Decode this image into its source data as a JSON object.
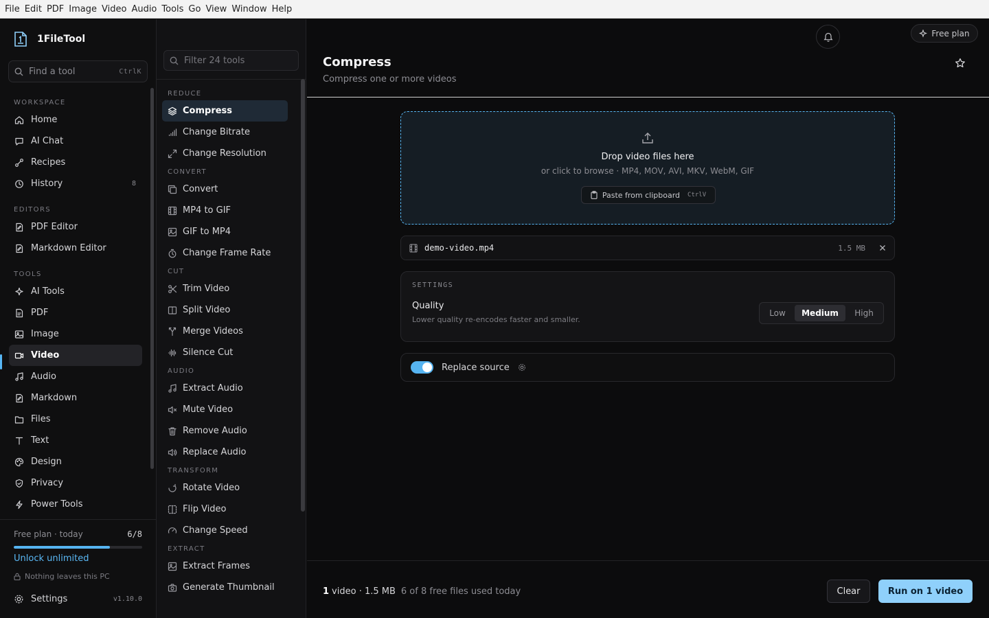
{
  "menubar": [
    "File",
    "Edit",
    "PDF",
    "Image",
    "Video",
    "Audio",
    "Tools",
    "Go",
    "View",
    "Window",
    "Help"
  ],
  "brand": {
    "name": "1FileTool"
  },
  "find": {
    "placeholder": "Find a tool",
    "shortcut": "CtrlK"
  },
  "sidebar": {
    "workspace_label": "WORKSPACE",
    "workspace": [
      {
        "label": "Home",
        "icon": "home-icon"
      },
      {
        "label": "AI Chat",
        "icon": "chat-icon"
      },
      {
        "label": "Recipes",
        "icon": "recipes-icon"
      },
      {
        "label": "History",
        "icon": "history-icon",
        "count": "8"
      }
    ],
    "editors_label": "EDITORS",
    "editors": [
      {
        "label": "PDF Editor",
        "icon": "pdf-editor-icon"
      },
      {
        "label": "Markdown Editor",
        "icon": "markdown-editor-icon"
      }
    ],
    "tools_label": "TOOLS",
    "tools": [
      {
        "label": "AI Tools",
        "icon": "sparkle-icon"
      },
      {
        "label": "PDF",
        "icon": "pdf-icon"
      },
      {
        "label": "Image",
        "icon": "image-icon"
      },
      {
        "label": "Video",
        "icon": "video-icon",
        "active": true
      },
      {
        "label": "Audio",
        "icon": "music-icon"
      },
      {
        "label": "Markdown",
        "icon": "markdown-icon"
      },
      {
        "label": "Files",
        "icon": "folder-icon"
      },
      {
        "label": "Text",
        "icon": "text-icon"
      },
      {
        "label": "Design",
        "icon": "palette-icon"
      },
      {
        "label": "Privacy",
        "icon": "shield-icon"
      },
      {
        "label": "Power Tools",
        "icon": "bolt-icon"
      }
    ]
  },
  "plan": {
    "label": "Free plan · today",
    "usage": "6/8",
    "progress_fraction": 0.75,
    "unlock": "Unlock unlimited",
    "privacy": "Nothing leaves this PC",
    "settings": "Settings",
    "version": "v1.10.0"
  },
  "toollist": {
    "filter_placeholder": "Filter 24 tools",
    "sections": [
      {
        "label": "REDUCE",
        "items": [
          {
            "label": "Compress",
            "active": true
          },
          {
            "label": "Change Bitrate"
          },
          {
            "label": "Change Resolution"
          }
        ]
      },
      {
        "label": "CONVERT",
        "items": [
          {
            "label": "Convert"
          },
          {
            "label": "MP4 to GIF"
          },
          {
            "label": "GIF to MP4"
          },
          {
            "label": "Change Frame Rate"
          }
        ]
      },
      {
        "label": "CUT",
        "items": [
          {
            "label": "Trim Video"
          },
          {
            "label": "Split Video"
          },
          {
            "label": "Merge Videos"
          },
          {
            "label": "Silence Cut"
          }
        ]
      },
      {
        "label": "AUDIO",
        "items": [
          {
            "label": "Extract Audio"
          },
          {
            "label": "Mute Video"
          },
          {
            "label": "Remove Audio"
          },
          {
            "label": "Replace Audio"
          }
        ]
      },
      {
        "label": "TRANSFORM",
        "items": [
          {
            "label": "Rotate Video"
          },
          {
            "label": "Flip Video"
          },
          {
            "label": "Change Speed"
          }
        ]
      },
      {
        "label": "EXTRACT",
        "items": [
          {
            "label": "Extract Frames"
          },
          {
            "label": "Generate Thumbnail"
          }
        ]
      }
    ]
  },
  "header": {
    "free_plan": "Free plan",
    "title": "Compress",
    "subtitle": "Compress one or more videos"
  },
  "dropzone": {
    "title": "Drop video files here",
    "subtitle": "or click to browse · MP4, MOV, AVI, MKV, WebM, GIF",
    "paste_label": "Paste from clipboard",
    "paste_shortcut": "CtrlV"
  },
  "file": {
    "name": "demo-video.mp4",
    "size": "1.5 MB"
  },
  "settings": {
    "label": "SETTINGS",
    "quality_label": "Quality",
    "quality_desc": "Lower quality re-encodes faster and smaller.",
    "options": [
      "Low",
      "Medium",
      "High"
    ],
    "selected": "Medium"
  },
  "replace": {
    "label": "Replace source",
    "enabled": true
  },
  "footer": {
    "count": "1",
    "count_suffix": "video · 1.5 MB",
    "usage_note": "6 of 8 free files used today",
    "clear": "Clear",
    "run": "Run on 1 video"
  },
  "colors": {
    "accent": "#56b4f1",
    "run_button": "#8fd0fb"
  }
}
